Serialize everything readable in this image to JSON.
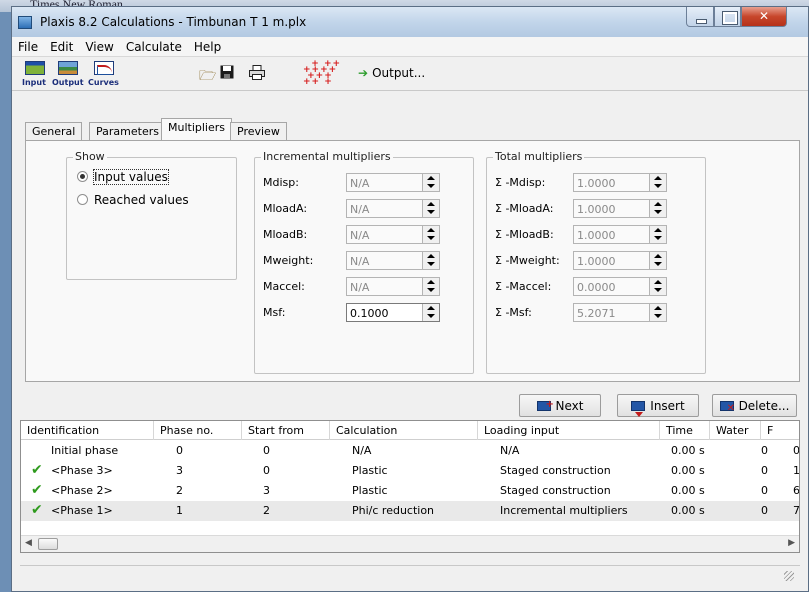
{
  "background_strip": {
    "text": "Times New Roman"
  },
  "window": {
    "title": "Plaxis 8.2 Calculations - Timbunan T 1 m.plx"
  },
  "menu": [
    "File",
    "Edit",
    "View",
    "Calculate",
    "Help"
  ],
  "toolbar": {
    "input_label": "Input",
    "output_label": "Output",
    "curves_label": "Curves",
    "output_button": "Output..."
  },
  "tabs": [
    "General",
    "Parameters",
    "Multipliers",
    "Preview"
  ],
  "active_tab": "Multipliers",
  "show_group": {
    "legend": "Show",
    "options": [
      "Input values",
      "Reached values"
    ],
    "selected": "Input values"
  },
  "incremental": {
    "legend": "Incremental multipliers",
    "fields": [
      {
        "label": "Mdisp:",
        "value": "N/A"
      },
      {
        "label": "MloadA:",
        "value": "N/A"
      },
      {
        "label": "MloadB:",
        "value": "N/A"
      },
      {
        "label": "Mweight:",
        "value": "N/A"
      },
      {
        "label": "Maccel:",
        "value": "N/A"
      },
      {
        "label": "Msf:",
        "value": "0.1000"
      }
    ]
  },
  "total": {
    "legend": "Total multipliers",
    "fields": [
      {
        "label": "Σ -Mdisp:",
        "value": "1.0000"
      },
      {
        "label": "Σ -MloadA:",
        "value": "1.0000"
      },
      {
        "label": "Σ -MloadB:",
        "value": "1.0000"
      },
      {
        "label": "Σ -Mweight:",
        "value": "1.0000"
      },
      {
        "label": "Σ -Maccel:",
        "value": "0.0000"
      },
      {
        "label": "Σ -Msf:",
        "value": "5.2071"
      }
    ]
  },
  "buttons": {
    "next": "Next",
    "insert": "Insert",
    "delete": "Delete..."
  },
  "phase_table": {
    "columns": [
      "Identification",
      "Phase no.",
      "Start from",
      "Calculation",
      "Loading input",
      "Time",
      "Water",
      "F"
    ],
    "rows": [
      {
        "id": "Initial phase",
        "phase": "0",
        "start": "0",
        "calc": "N/A",
        "loading": "N/A",
        "time": "0.00 s",
        "water": "0",
        "f": "0",
        "done": false
      },
      {
        "id": "<Phase 3>",
        "phase": "3",
        "start": "0",
        "calc": "Plastic",
        "loading": "Staged construction",
        "time": "0.00 s",
        "water": "0",
        "f": "1",
        "done": true
      },
      {
        "id": "<Phase 2>",
        "phase": "2",
        "start": "3",
        "calc": "Plastic",
        "loading": "Staged construction",
        "time": "0.00 s",
        "water": "0",
        "f": "6",
        "done": true
      },
      {
        "id": "<Phase 1>",
        "phase": "1",
        "start": "2",
        "calc": "Phi/c reduction",
        "loading": "Incremental multipliers",
        "time": "0.00 s",
        "water": "0",
        "f": "7",
        "done": true
      }
    ]
  },
  "colors": {
    "titlebar": "#c2d5ea",
    "close_button": "#c7462b",
    "check": "#2e9a1d",
    "plus_marks": "#d61d1d"
  }
}
